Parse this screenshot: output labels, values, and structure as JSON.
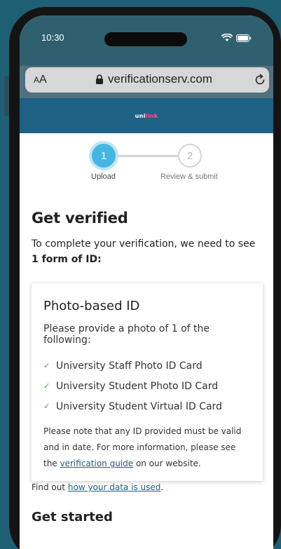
{
  "status": {
    "time": "10:30"
  },
  "browser": {
    "aa_label_small": "A",
    "aa_label": "A",
    "url": "verificationserv.com"
  },
  "brand": {
    "name_a": "uni",
    "name_b": "link"
  },
  "stepper": {
    "steps": [
      {
        "number": "1",
        "label": "Upload"
      },
      {
        "number": "2",
        "label": "Review & submit"
      }
    ]
  },
  "main": {
    "title": "Get verified",
    "intro_text": "To complete your verification, we need to see ",
    "intro_bold": "1 form of ID:"
  },
  "card": {
    "title": "Photo-based ID",
    "subtitle": "Please provide a photo of 1 of the following:",
    "items": [
      "University Staff Photo ID Card",
      "University Student Photo ID Card",
      "University Student Virtual ID Card"
    ],
    "note_prefix": "Please note that any ID provided must be valid and in date. For more information, please see the ",
    "note_link": "verification guide",
    "note_suffix": " on our website."
  },
  "footer": {
    "findout_prefix": "Find out ",
    "findout_link": "how your data is used",
    "findout_suffix": "."
  },
  "get_started": {
    "title": "Get started"
  },
  "colors": {
    "background": "#1f5f74",
    "brand_bar": "#1f6085",
    "step_active": "#45b6e3",
    "check": "#3aa552",
    "link": "#1f5f85"
  }
}
